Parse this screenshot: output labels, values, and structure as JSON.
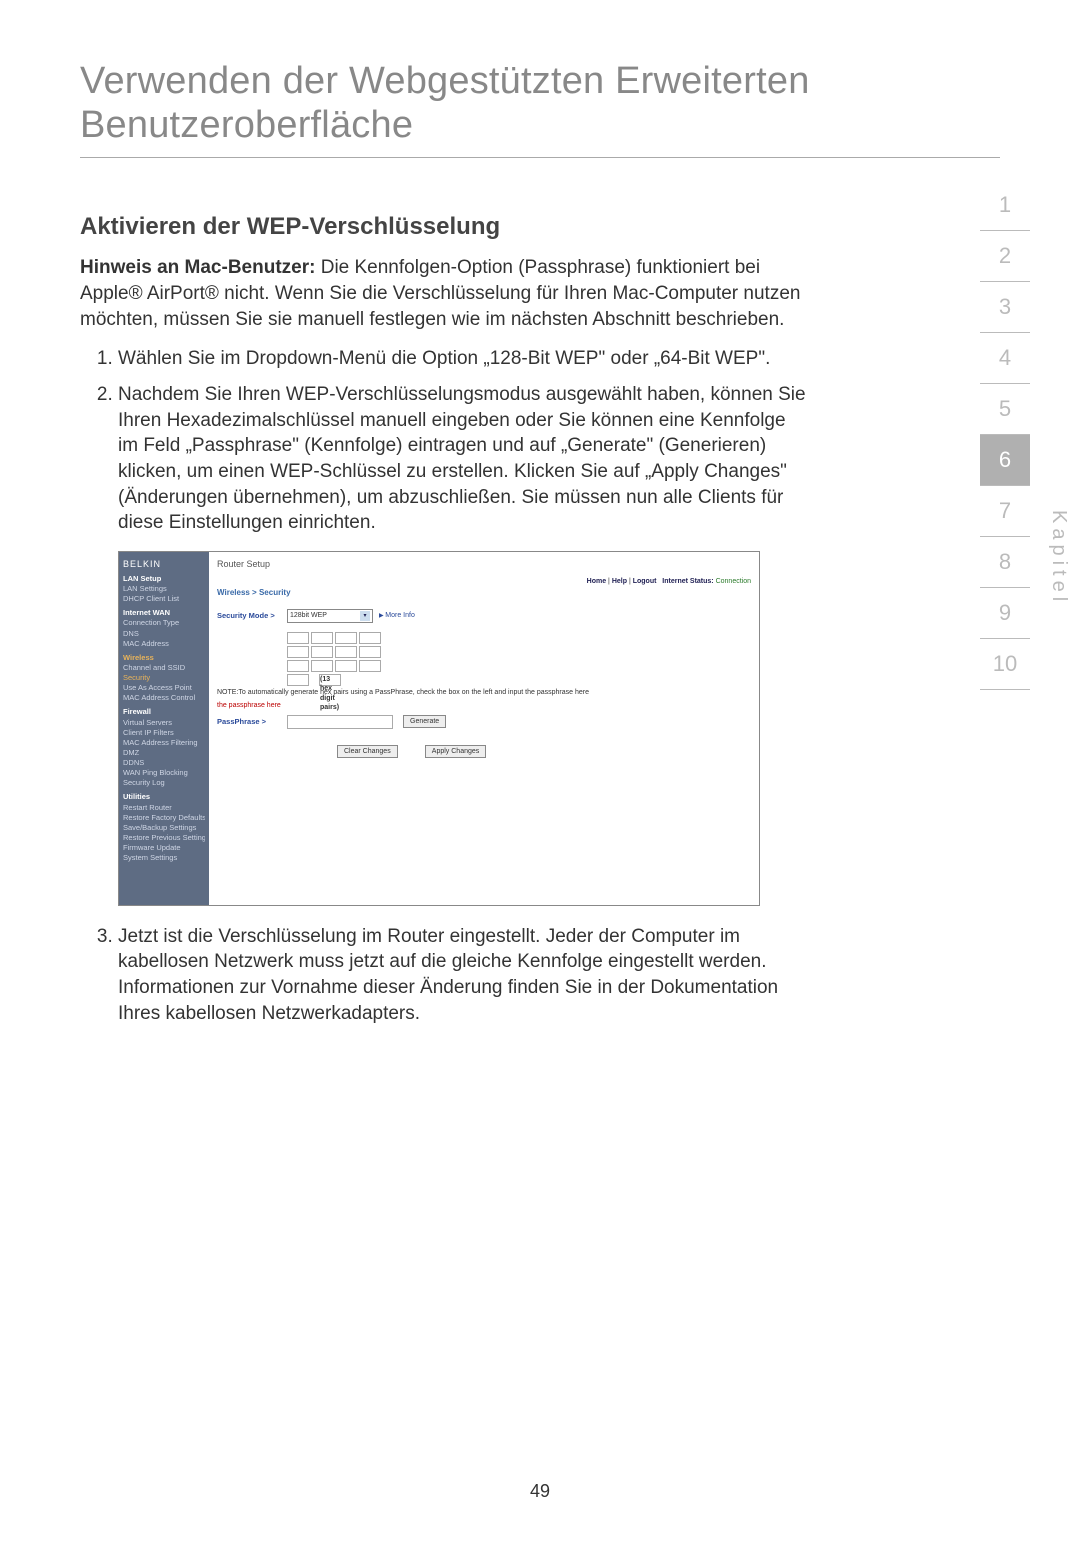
{
  "title": "Verwenden der Webgestützten Erweiterten Benutzeroberfläche",
  "section_heading": "Aktivieren der WEP-Verschlüsselung",
  "hint_label": "Hinweis an Mac-Benutzer:",
  "hint_text": " Die Kennfolgen-Option (Passphrase) funktioniert bei Apple® AirPort® nicht. Wenn Sie die Verschlüsselung für Ihren Mac-Computer nutzen möchten, müssen Sie sie manuell festlegen wie im nächsten Abschnitt beschrieben.",
  "steps": [
    "Wählen Sie im Dropdown-Menü die Option „128-Bit WEP\" oder „64-Bit WEP\".",
    "Nachdem Sie Ihren WEP-Verschlüsselungsmodus ausgewählt haben, können Sie Ihren Hexadezimalschlüssel manuell eingeben oder Sie können eine Kennfolge im Feld „Passphrase\" (Kennfolge) eintragen und auf „Generate\" (Generieren) klicken, um einen WEP-Schlüssel zu erstellen. Klicken Sie auf „Apply Changes\" (Änderungen übernehmen), um abzuschließen. Sie müssen nun alle Clients für diese Einstellungen einrichten.",
    "Jetzt ist die Verschlüsselung im Router eingestellt. Jeder der Computer im kabellosen Netzwerk muss jetzt auf die gleiche Kennfolge eingestellt werden. Informationen zur Vornahme dieser Änderung finden Sie in der Dokumentation Ihres kabellosen Netzwerkadapters."
  ],
  "tabs": [
    "1",
    "2",
    "3",
    "4",
    "5",
    "6",
    "7",
    "8",
    "9",
    "10"
  ],
  "tab_active_index": 5,
  "kapitel_label": "Kapitel",
  "page_number": "49",
  "router": {
    "brand": "BELKIN",
    "toptitle": "Router Setup",
    "toplinks": {
      "home": "Home",
      "help": "Help",
      "logout": "Logout",
      "status_label": "Internet Status:",
      "status_value": "Connection"
    },
    "sidebar": {
      "groups": [
        {
          "header": "LAN Setup",
          "items": [
            "LAN Settings",
            "DHCP Client List"
          ]
        },
        {
          "header": "Internet WAN",
          "items": [
            "Connection Type",
            "DNS",
            "MAC Address"
          ]
        },
        {
          "header": "Wireless",
          "items": [
            "Channel and SSID",
            "Security",
            "Use As Access Point",
            "MAC Address Control"
          ],
          "current_index": 1
        },
        {
          "header": "Firewall",
          "items": [
            "Virtual Servers",
            "Client IP Filters",
            "MAC Address Filtering",
            "DMZ",
            "DDNS",
            "WAN Ping Blocking",
            "Security Log"
          ]
        },
        {
          "header": "Utilities",
          "items": [
            "Restart Router",
            "Restore Factory Defaults",
            "Save/Backup Settings",
            "Restore Previous Settings",
            "Firmware Update",
            "System Settings"
          ]
        }
      ]
    },
    "breadcrumb": "Wireless > Security",
    "security_mode_label": "Security Mode >",
    "security_mode_value": "128bit WEP",
    "more_info": "More Info",
    "hex_pairs_label": "(13 hex digit pairs)",
    "note_prefix": "NOTE:",
    "note_text": "To automatically generate hex pairs using a PassPhrase, check the box on the left and input the passphrase here",
    "passphrase_label": "PassPhrase >",
    "btn_generate": "Generate",
    "btn_clear": "Clear Changes",
    "btn_apply": "Apply Changes"
  }
}
